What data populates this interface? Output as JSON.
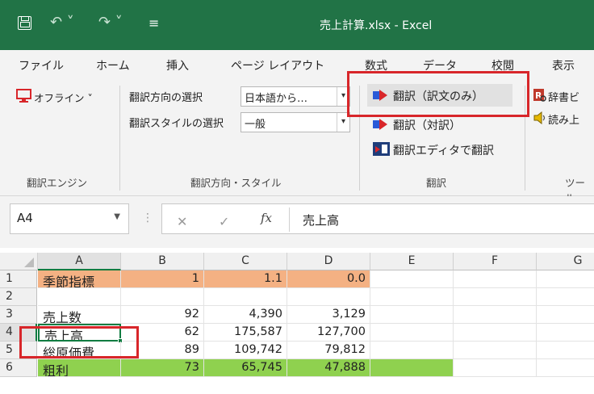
{
  "app": {
    "title": "売上計算.xlsx  -  Excel",
    "undo_glyph": "↶ ˅",
    "redo_glyph": "↷ ˅",
    "qat_glyph": "≡"
  },
  "menu": {
    "tabs": [
      "ファイル",
      "ホーム",
      "挿入",
      "ページ レイアウト",
      "数式",
      "データ",
      "校閲",
      "表示"
    ]
  },
  "ribbon": {
    "offline_label": "オフライン ˅",
    "group_engine_label": "翻訳エンジン",
    "direction_label": "翻訳方向の選択",
    "direction_value": "日本語から…",
    "style_label": "翻訳スタイルの選択",
    "style_value": "一般",
    "group_direction_label": "翻訳方向・スタイル",
    "translate_only_label": "翻訳（訳文のみ）",
    "translate_parallel_label": "翻訳（対訳）",
    "translate_editor_label": "翻訳エディタで翻訳",
    "group_translate_label": "翻訳",
    "dictionary_label": "辞書ビ",
    "read_aloud_label": "読み上",
    "group_tools_label": "ツール"
  },
  "formula_bar": {
    "name_box": "A4",
    "cancel_glyph": "✕",
    "enter_glyph": "✓",
    "fx_label": "fx",
    "value": "売上高"
  },
  "sheet": {
    "columns": [
      "A",
      "B",
      "C",
      "D",
      "E",
      "F",
      "G"
    ],
    "row_numbers": [
      "1",
      "2",
      "3",
      "4",
      "5",
      "6"
    ],
    "rows": [
      [
        "季節指標",
        "1",
        "1.1",
        "0.0"
      ],
      [
        "",
        "",
        "",
        ""
      ],
      [
        "売上数",
        "92",
        "4,390",
        "3,129"
      ],
      [
        "売上高",
        "62",
        "175,587",
        "127,700"
      ],
      [
        "総原価費",
        "89",
        "109,742",
        "79,812"
      ],
      [
        "粗利",
        "73",
        "65,745",
        "47,888"
      ]
    ]
  },
  "colors": {
    "title_bar": "#217346",
    "row1_fill": "#f4b183",
    "row6_fill": "#8fd14f",
    "highlight_red": "#d8262a",
    "selection_green": "#107c41"
  }
}
